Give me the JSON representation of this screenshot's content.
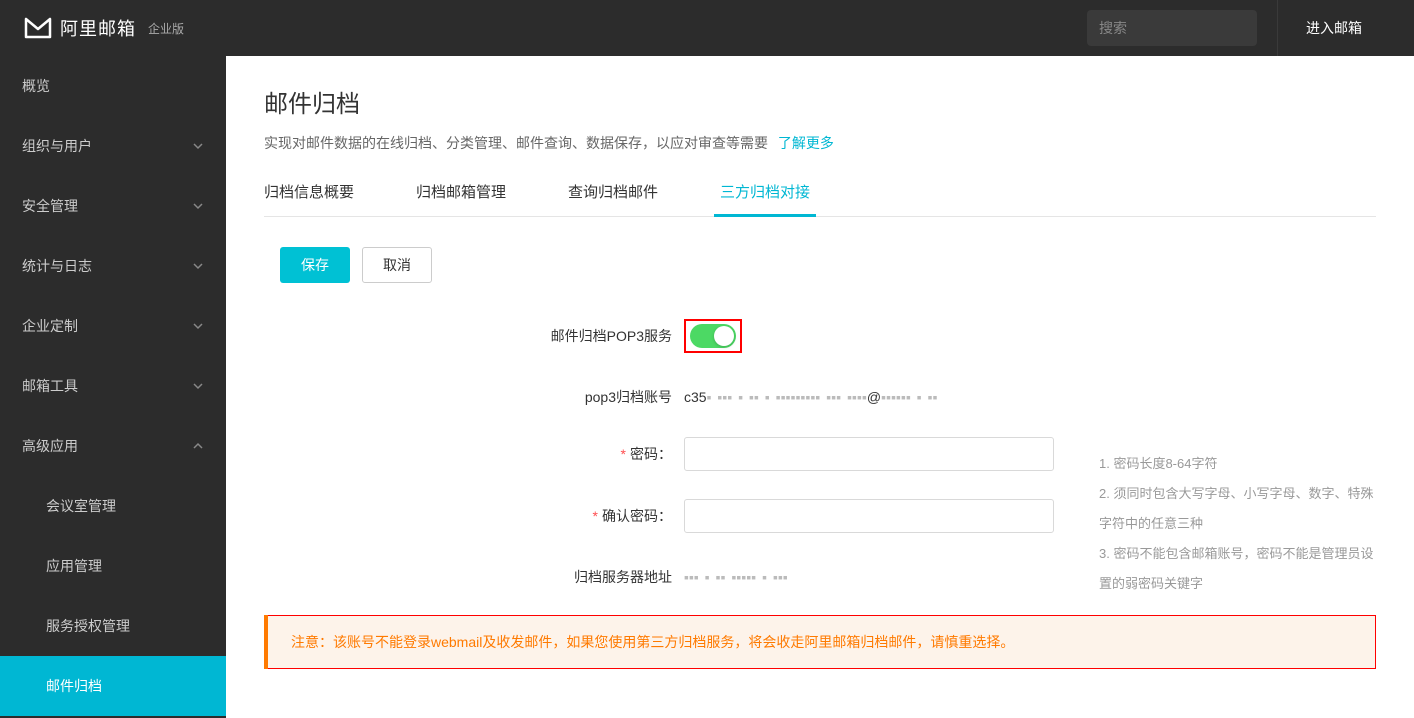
{
  "header": {
    "brand": "阿里邮箱",
    "edition": "企业版",
    "search_placeholder": "搜索",
    "enter_mail": "进入邮箱"
  },
  "sidebar": {
    "items": [
      {
        "label": "概览",
        "expandable": false
      },
      {
        "label": "组织与用户",
        "expandable": true,
        "open": false
      },
      {
        "label": "安全管理",
        "expandable": true,
        "open": false
      },
      {
        "label": "统计与日志",
        "expandable": true,
        "open": false
      },
      {
        "label": "企业定制",
        "expandable": true,
        "open": false
      },
      {
        "label": "邮箱工具",
        "expandable": true,
        "open": false
      },
      {
        "label": "高级应用",
        "expandable": true,
        "open": true
      }
    ],
    "subitems": [
      {
        "label": "会议室管理",
        "active": false
      },
      {
        "label": "应用管理",
        "active": false
      },
      {
        "label": "服务授权管理",
        "active": false
      },
      {
        "label": "邮件归档",
        "active": true
      }
    ]
  },
  "page": {
    "title": "邮件归档",
    "desc": "实现对邮件数据的在线归档、分类管理、邮件查询、数据保存，以应对审查等需要",
    "learn_more": "了解更多"
  },
  "tabs": [
    {
      "label": "归档信息概要",
      "active": false
    },
    {
      "label": "归档邮箱管理",
      "active": false
    },
    {
      "label": "查询归档邮件",
      "active": false
    },
    {
      "label": "三方归档对接",
      "active": true
    }
  ],
  "actions": {
    "save": "保存",
    "cancel": "取消"
  },
  "form": {
    "pop3_service_label": "邮件归档POP3服务",
    "pop3_account_label": "pop3归档账号",
    "pop3_account_value_prefix": "c35",
    "pop3_account_value_at": "@",
    "password_label": "密码：",
    "confirm_password_label": "确认密码：",
    "server_addr_label": "归档服务器地址"
  },
  "hints": [
    "1. 密码长度8-64字符",
    "2. 须同时包含大写字母、小写字母、数字、特殊字符中的任意三种",
    "3. 密码不能包含邮箱账号，密码不能是管理员设置的弱密码关键字"
  ],
  "warning": "注意：该账号不能登录webmail及收发邮件，如果您使用第三方归档服务，将会收走阿里邮箱归档邮件，请慎重选择。"
}
